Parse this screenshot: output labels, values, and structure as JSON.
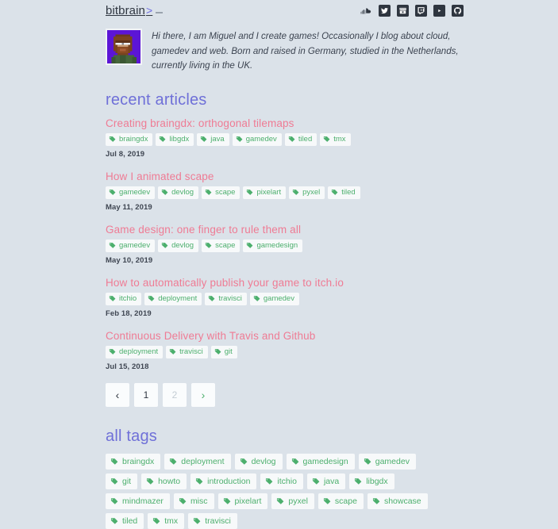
{
  "header": {
    "brand_name": "bitbrain",
    "brand_chevron": ">",
    "social_links": [
      {
        "name": "soundcloud-icon",
        "label": "SoundCloud"
      },
      {
        "name": "twitter-icon",
        "label": "Twitter"
      },
      {
        "name": "itchio-icon",
        "label": "itch.io"
      },
      {
        "name": "twitch-icon",
        "label": "Twitch"
      },
      {
        "name": "youtube-icon",
        "label": "YouTube"
      },
      {
        "name": "github-icon",
        "label": "GitHub"
      }
    ]
  },
  "bio": {
    "avatar_alt": "pixel art avatar of bearded man with glasses",
    "text": "Hi there, I am Miguel and I create games! Occasionally I blog about cloud, gamedev and web. Born and raised in Germany, studied in the Netherlands, currently living in the UK."
  },
  "recent_articles": {
    "heading": "recent articles",
    "items": [
      {
        "title": "Creating braingdx: orthogonal tilemaps",
        "tags": [
          "braingdx",
          "libgdx",
          "java",
          "gamedev",
          "tiled",
          "tmx"
        ],
        "date": "Jul 8, 2019"
      },
      {
        "title": "How I animated scape",
        "tags": [
          "gamedev",
          "devlog",
          "scape",
          "pixelart",
          "pyxel",
          "tiled"
        ],
        "date": "May 11, 2019"
      },
      {
        "title": "Game design: one finger to rule them all",
        "tags": [
          "gamedev",
          "devlog",
          "scape",
          "gamedesign"
        ],
        "date": "May 10, 2019"
      },
      {
        "title": "How to automatically publish your game to itch.io",
        "tags": [
          "itchio",
          "deployment",
          "travisci",
          "gamedev"
        ],
        "date": "Feb 18, 2019"
      },
      {
        "title": "Continuous Delivery with Travis and Github",
        "tags": [
          "deployment",
          "travisci",
          "git"
        ],
        "date": "Jul 15, 2018"
      }
    ]
  },
  "pagination": {
    "prev_label": "‹",
    "next_label": "›",
    "pages": [
      "1",
      "2"
    ],
    "current_page": "1"
  },
  "all_tags": {
    "heading": "all tags",
    "items": [
      "braingdx",
      "deployment",
      "devlog",
      "gamedesign",
      "gamedev",
      "git",
      "howto",
      "introduction",
      "itchio",
      "java",
      "libgdx",
      "mindmazer",
      "misc",
      "pixelart",
      "pyxel",
      "scape",
      "showcase",
      "tiled",
      "tmx",
      "travisci"
    ]
  },
  "colors": {
    "page_background": "#dbe2e9",
    "heading": "#6f70d8",
    "article_title": "#ef7b94",
    "tag_text": "#4caf6d",
    "tag_background": "#f7f9fa",
    "brand": "#2f3640",
    "avatar_background": "#5c15d6"
  }
}
